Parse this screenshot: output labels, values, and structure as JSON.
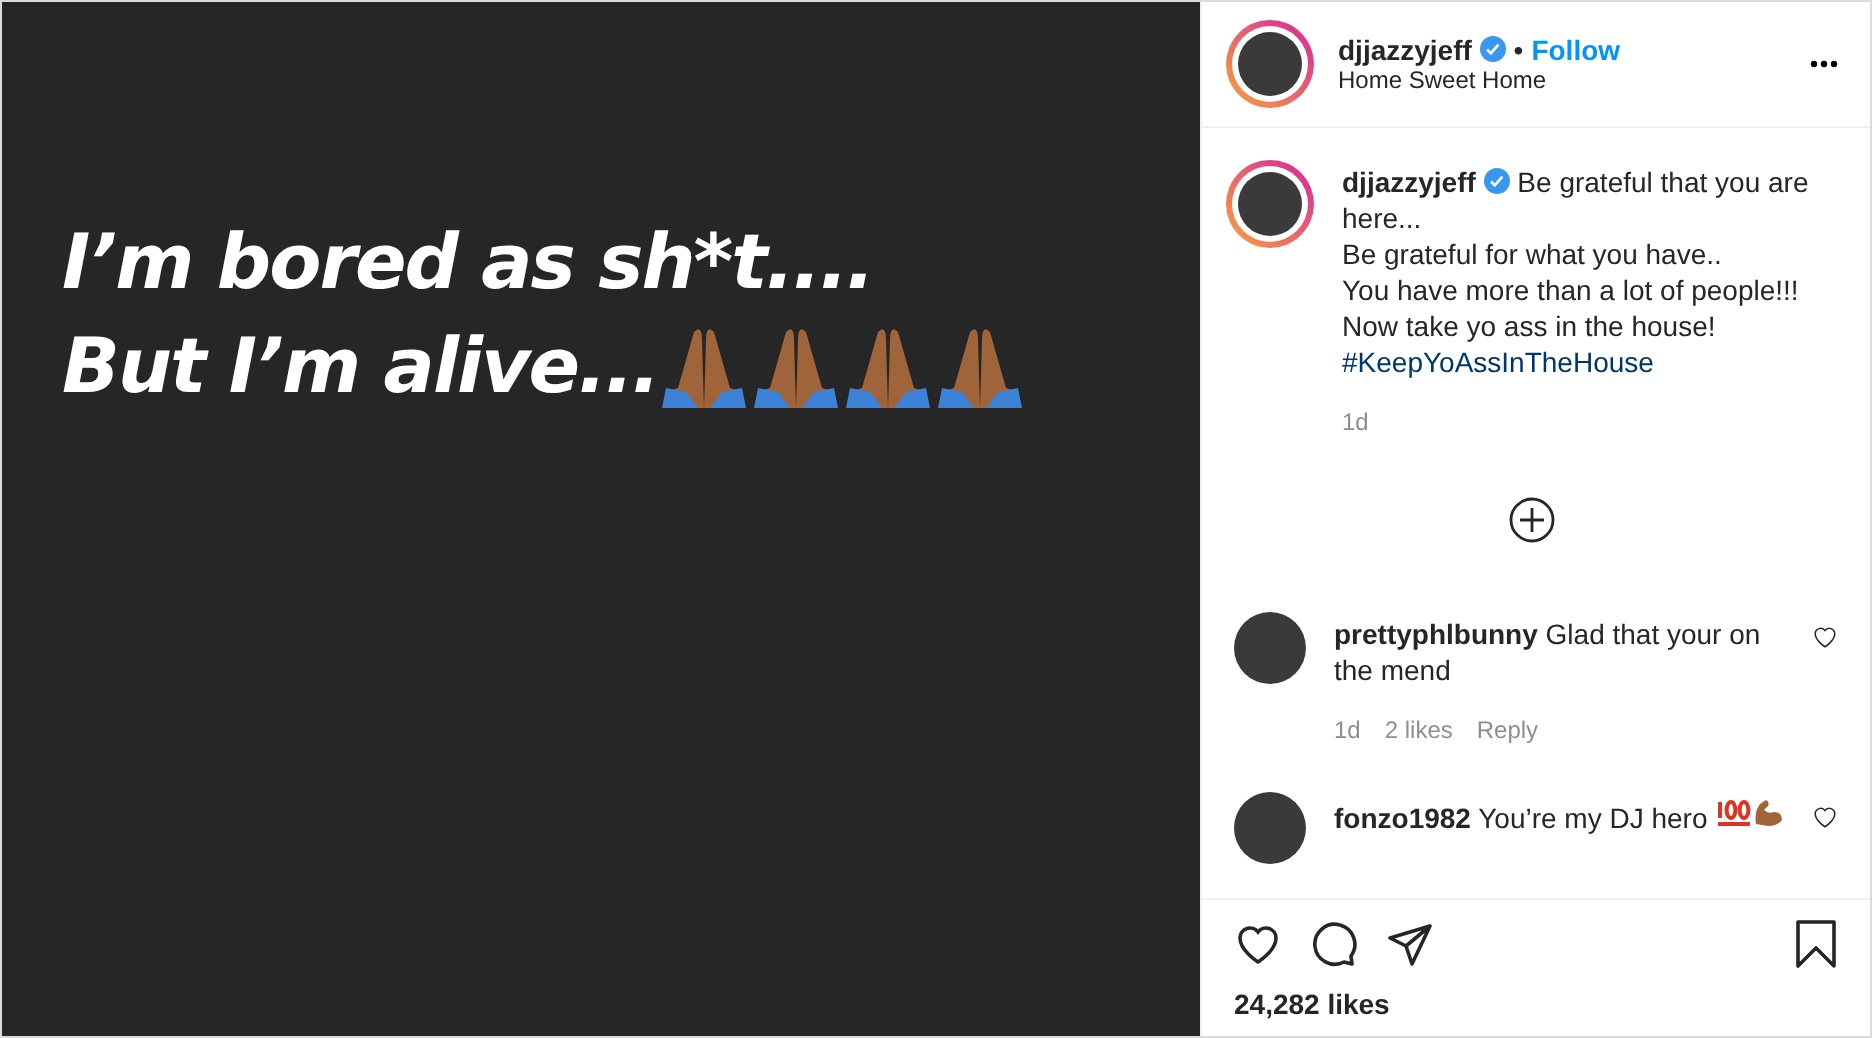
{
  "post_image": {
    "lines": [
      "I’m bored as sh*t....",
      "But I’m alive..."
    ]
  },
  "header": {
    "username": "djjazzyjeff",
    "verified": true,
    "separator": "•",
    "follow": "Follow",
    "location": "Home Sweet Home"
  },
  "caption": {
    "username": "djjazzyjeff",
    "verified": true,
    "lines": [
      "Be grateful that you are here...",
      "Be grateful for what you have..",
      "You have more than a lot of people!!!",
      "Now take yo ass in the house!"
    ],
    "hashtag": "#KeepYoAssInTheHouse",
    "time": "1d"
  },
  "comments": [
    {
      "username": "prettyphlbunny",
      "text": "Glad that your on the mend",
      "time": "1d",
      "likes": "2 likes",
      "reply": "Reply",
      "liked": false
    },
    {
      "username": "fonzo1982",
      "text": "You’re my DJ hero",
      "liked": false
    }
  ],
  "likes": "24,282 likes"
}
